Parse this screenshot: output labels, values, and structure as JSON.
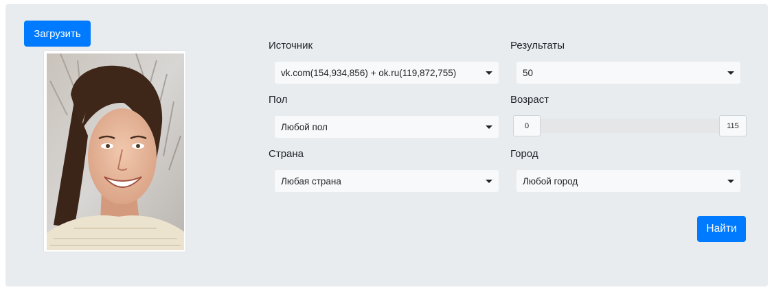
{
  "upload_button": "Загрузить",
  "search_button": "Найти",
  "fields": {
    "source": {
      "label": "Источник",
      "value": "vk.com(154,934,856) + ok.ru(119,872,755)"
    },
    "results": {
      "label": "Результаты",
      "value": "50"
    },
    "gender": {
      "label": "Пол",
      "value": "Любой пол"
    },
    "age": {
      "label": "Возраст",
      "min": "0",
      "max": "115"
    },
    "country": {
      "label": "Страна",
      "value": "Любая страна"
    },
    "city": {
      "label": "Город",
      "value": "Любой город"
    }
  },
  "colors": {
    "primary": "#007bff",
    "panel_bg": "#e9ecef",
    "select_bg": "#f8f9fa"
  },
  "icons": {
    "dropdown": "caret-down-icon"
  }
}
